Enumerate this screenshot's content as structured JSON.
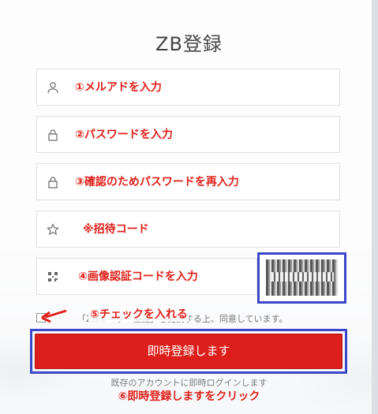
{
  "title": "ZB登録",
  "fields": {
    "email": {
      "placeholder": "①メルアドを入力",
      "icon": "user-icon"
    },
    "password": {
      "placeholder": "②パスワードを入力",
      "icon": "lock-icon"
    },
    "password_confirm": {
      "placeholder": "③確認のためパスワードを再入力",
      "icon": "lock-icon"
    },
    "invite": {
      "placeholder": "※招待コード",
      "icon": "star-icon"
    },
    "captcha": {
      "placeholder": "④画像認証コードを入力",
      "icon": "captcha-icon"
    }
  },
  "agreement": {
    "text": "「ZBユーザー協議」を閲読する上、同意しています。",
    "annotation": "⑤チェックを入れる"
  },
  "submit": {
    "label": "即時登録します"
  },
  "login_link": "既存のアカウントに即時ログインします",
  "step6": "⑥即時登録しますをクリック",
  "colors": {
    "accent": "#dc1f1a",
    "annotation": "#e0201a",
    "highlight": "#3a47c8"
  }
}
